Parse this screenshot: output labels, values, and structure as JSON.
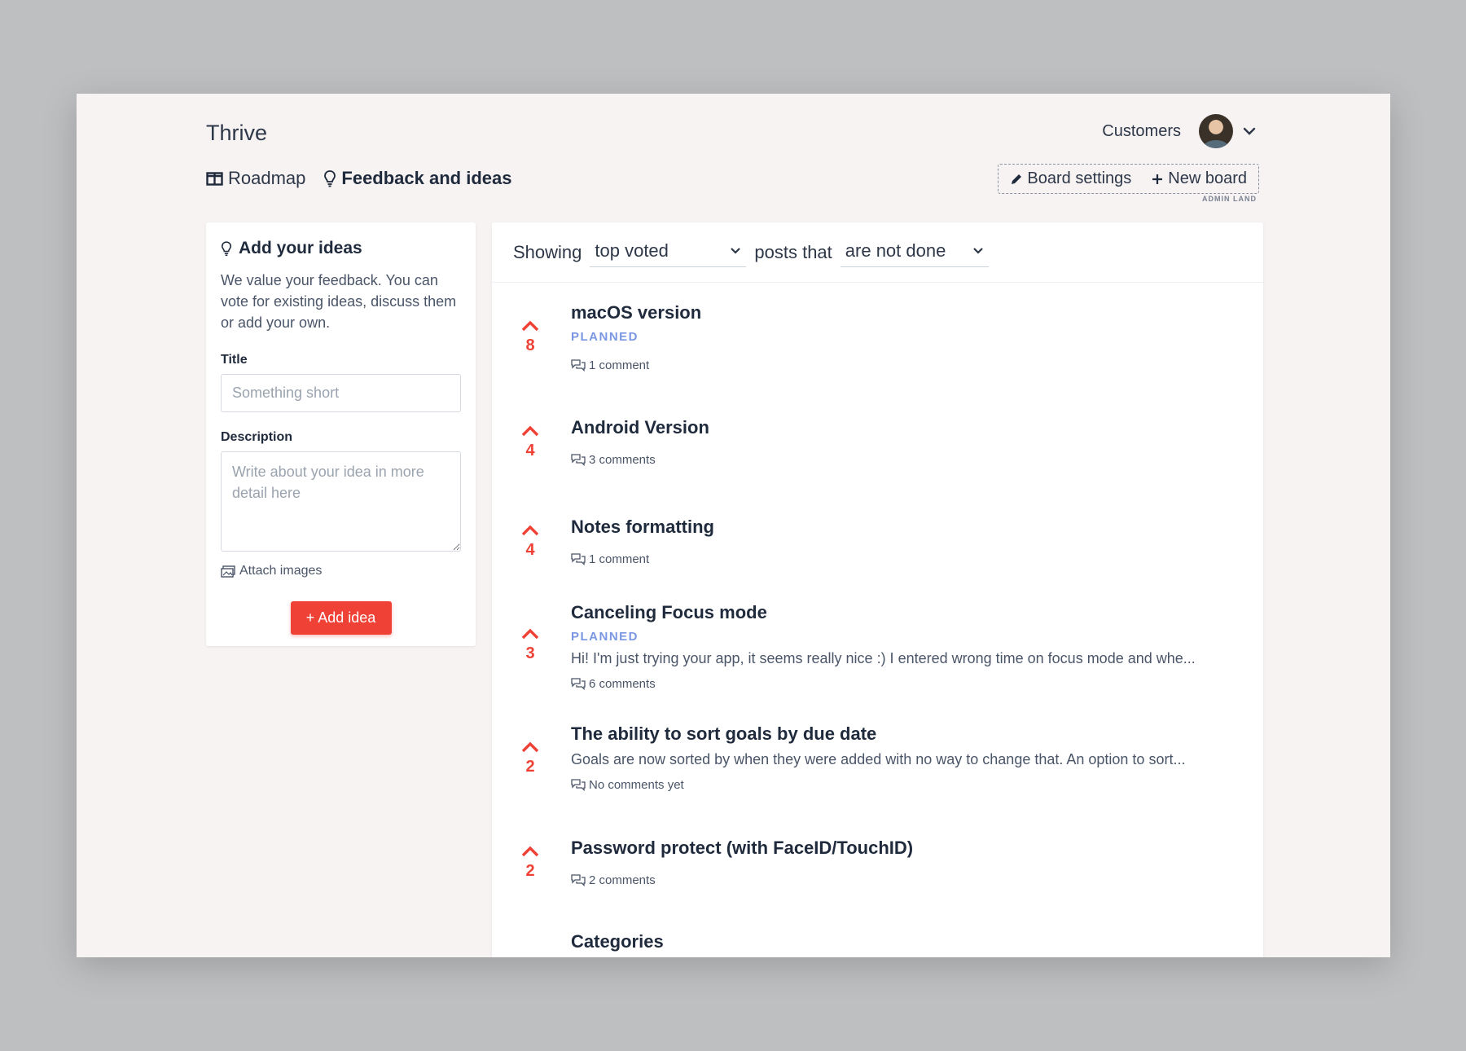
{
  "header": {
    "brand": "Thrive",
    "customers_label": "Customers",
    "nav": [
      {
        "label": "Roadmap"
      },
      {
        "label": "Feedback and ideas"
      }
    ],
    "board_settings_label": "Board settings",
    "new_board_label": "New board",
    "admin_land_label": "ADMIN LAND"
  },
  "add_idea": {
    "title": "Add your ideas",
    "description": "We value your feedback. You can vote for existing ideas, discuss them or add your own.",
    "title_label": "Title",
    "title_placeholder": "Something short",
    "description_label": "Description",
    "description_placeholder": "Write about your idea in more detail here",
    "attach_label": "Attach images",
    "button_label": "+ Add idea"
  },
  "filter": {
    "showing_label": "Showing",
    "sort_value": "top voted",
    "posts_that_label": "posts that",
    "status_value": "are not done"
  },
  "posts": [
    {
      "votes": "8",
      "title": "macOS version",
      "status": "PLANNED",
      "description": "",
      "comments": "1 comment"
    },
    {
      "votes": "4",
      "title": "Android Version",
      "status": "",
      "description": "",
      "comments": "3 comments"
    },
    {
      "votes": "4",
      "title": "Notes formatting",
      "status": "",
      "description": "",
      "comments": "1 comment"
    },
    {
      "votes": "3",
      "title": "Canceling Focus mode",
      "status": "PLANNED",
      "description": "Hi! I'm just trying your app, it seems really nice :) I entered wrong time on focus mode and whe...",
      "comments": "6 comments"
    },
    {
      "votes": "2",
      "title": "The ability to sort goals by due date",
      "status": "",
      "description": "Goals are now sorted by when they were added with no way to change that. An option to sort...",
      "comments": "No comments yet"
    },
    {
      "votes": "2",
      "title": "Password protect (with FaceID/TouchID)",
      "status": "",
      "description": "",
      "comments": "2 comments"
    },
    {
      "votes": "",
      "title": "Categories",
      "status": "",
      "description": "",
      "comments": ""
    }
  ],
  "colors": {
    "accent_red": "#ef4136",
    "planned_blue": "#7b97e3"
  }
}
